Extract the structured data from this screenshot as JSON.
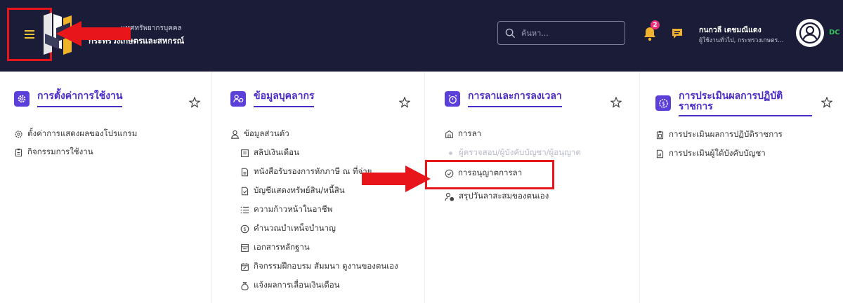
{
  "header": {
    "org_line1": "แทศทรัพยากรบุคคล",
    "org_line2": "กระทรวงเกษตรและสหกรณ์",
    "search_placeholder": "ค้นหา...",
    "notification_count": "2",
    "user_name": "กนกวลี เตชมณีแดง",
    "user_role": "ผู้ใช้งานทั่วไป, กระทรวงเกษตร...",
    "avatar_tag": "DC",
    "icons": [
      "menu-icon",
      "search-icon",
      "bell-icon",
      "chat-icon",
      "user-icon"
    ]
  },
  "colors": {
    "header_bg": "#1b1c37",
    "accent": "#4a2bc7",
    "highlight": "#e8161b",
    "badge": "#e8317a",
    "online": "#2fc55a"
  },
  "columns": [
    {
      "title": "การตั้งค่าการใช้งาน",
      "items": [
        {
          "label": "ตั้งค่าการแสดงผลของโปรแกรม"
        },
        {
          "label": "กิจกรรมการใช้งาน"
        }
      ]
    },
    {
      "title": "ข้อมูลบุคลากร",
      "items": [
        {
          "label": "ข้อมูลส่วนตัว"
        },
        {
          "label": "สลิปเงินเดือน"
        },
        {
          "label": "หนังสือรับรองการหักภาษี ณ ที่จ่าย"
        },
        {
          "label": "บัญชีแสดงทรัพย์สิน/หนี้สิน"
        },
        {
          "label": "ความก้าวหน้าในอาชีพ"
        },
        {
          "label": "คำนวณบำเหน็จบำนาญ"
        },
        {
          "label": "เอกสารหลักฐาน"
        },
        {
          "label": "กิจกรรมฝึกอบรม สัมมนา ดูงานของตนเอง"
        },
        {
          "label": "แจ้งผลการเลื่อนเงินเดือน"
        }
      ]
    },
    {
      "title": "การลาและการลงเวลา",
      "items": [
        {
          "label": "การลา"
        },
        {
          "label": "ผู้ตรวจสอบ/ผู้บังคับบัญชา/ผู้อนุญาต"
        },
        {
          "label": "การอนุญาตการลา"
        },
        {
          "label": "สรุปวันลาสะสมของตนเอง"
        }
      ]
    },
    {
      "title": "การประเมินผลการปฏิบัติราชการ",
      "items": [
        {
          "label": "การประเมินผลการปฏิบัติราชการ"
        },
        {
          "label": "การประเมินผู้ใต้บังคับบัญชา"
        }
      ]
    }
  ]
}
